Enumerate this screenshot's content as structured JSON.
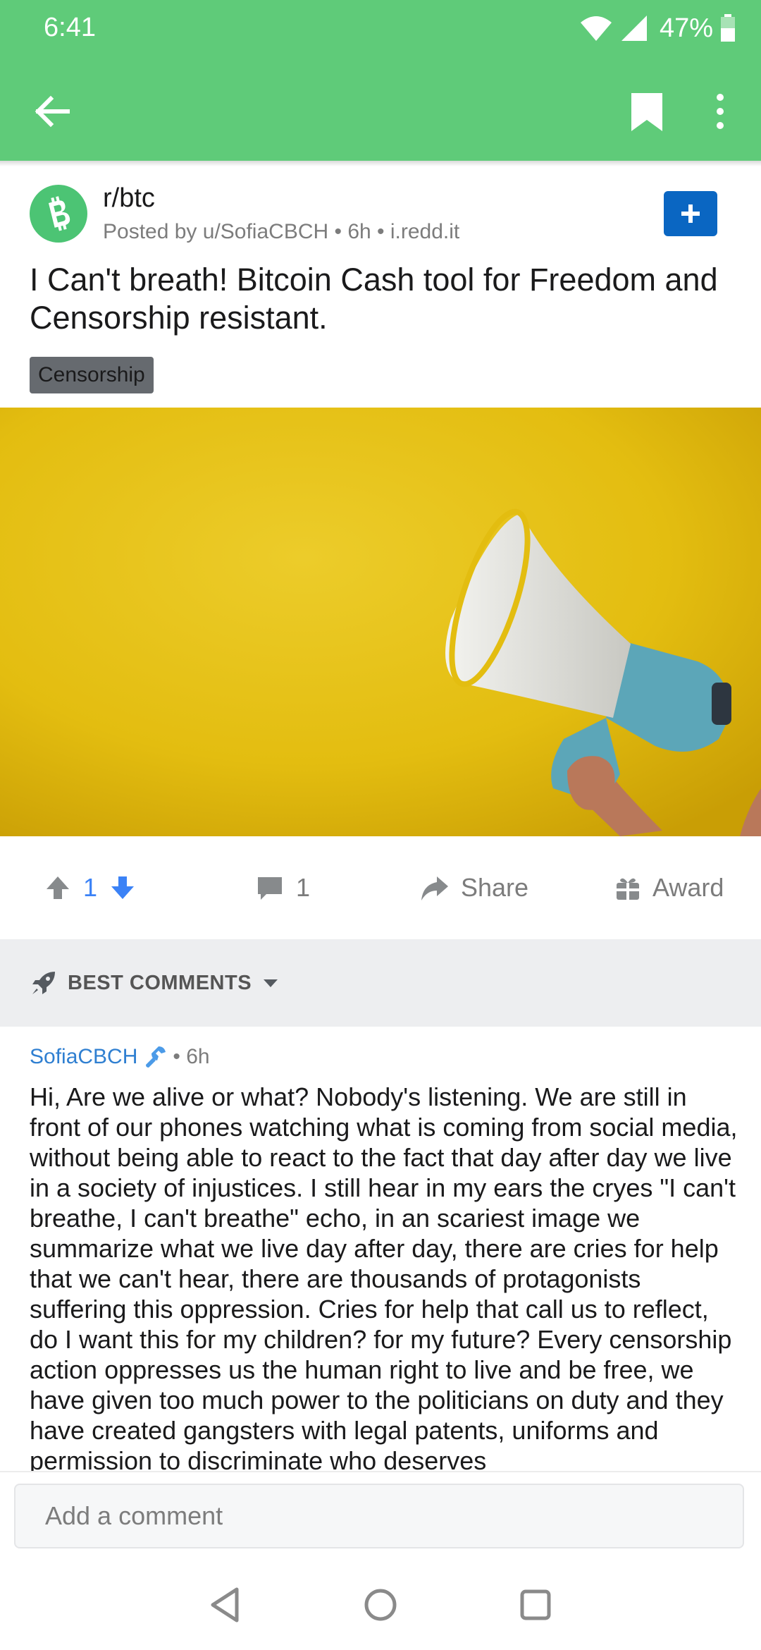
{
  "status_bar": {
    "time": "6:41",
    "battery": "47%"
  },
  "post": {
    "subreddit": "r/btc",
    "meta": "Posted by u/SofiaCBCH • 6h • i.redd.it",
    "title": "I Can't breath! Bitcoin Cash tool for Freedom and Censorship resistant.",
    "flair": "Censorship"
  },
  "actions": {
    "vote_count": "1",
    "comment_count": "1",
    "share_label": "Share",
    "award_label": "Award"
  },
  "sort": {
    "label": "BEST COMMENTS"
  },
  "comment": {
    "author": "SofiaCBCH",
    "age": "• 6h",
    "body": "Hi, Are we alive or what? Nobody's listening. We are still in front of our phones watching what is coming from social media, without being able to react to the fact that day after day we live in a society of injustices. I still hear in my ears the cryes \"I can't breathe, I can't breathe\" echo, in an scariest image we summarize what we live day after day, there are cries for help that we can't hear, there are thousands of protagonists suffering this oppression. Cries for help that call us to reflect, do I want this for my children? for my future? Every censorship action oppresses us the human right to live and be free, we have given too much power to the politicians on duty and they have created gangsters with legal patents, uniforms and permission to discriminate who deserves"
  },
  "composer": {
    "placeholder": "Add a comment"
  },
  "colors": {
    "app_green": "#5fcb79",
    "join_blue": "#0a66c2",
    "author_blue": "#2f7fd1",
    "vote_blue": "#3b82f6"
  }
}
